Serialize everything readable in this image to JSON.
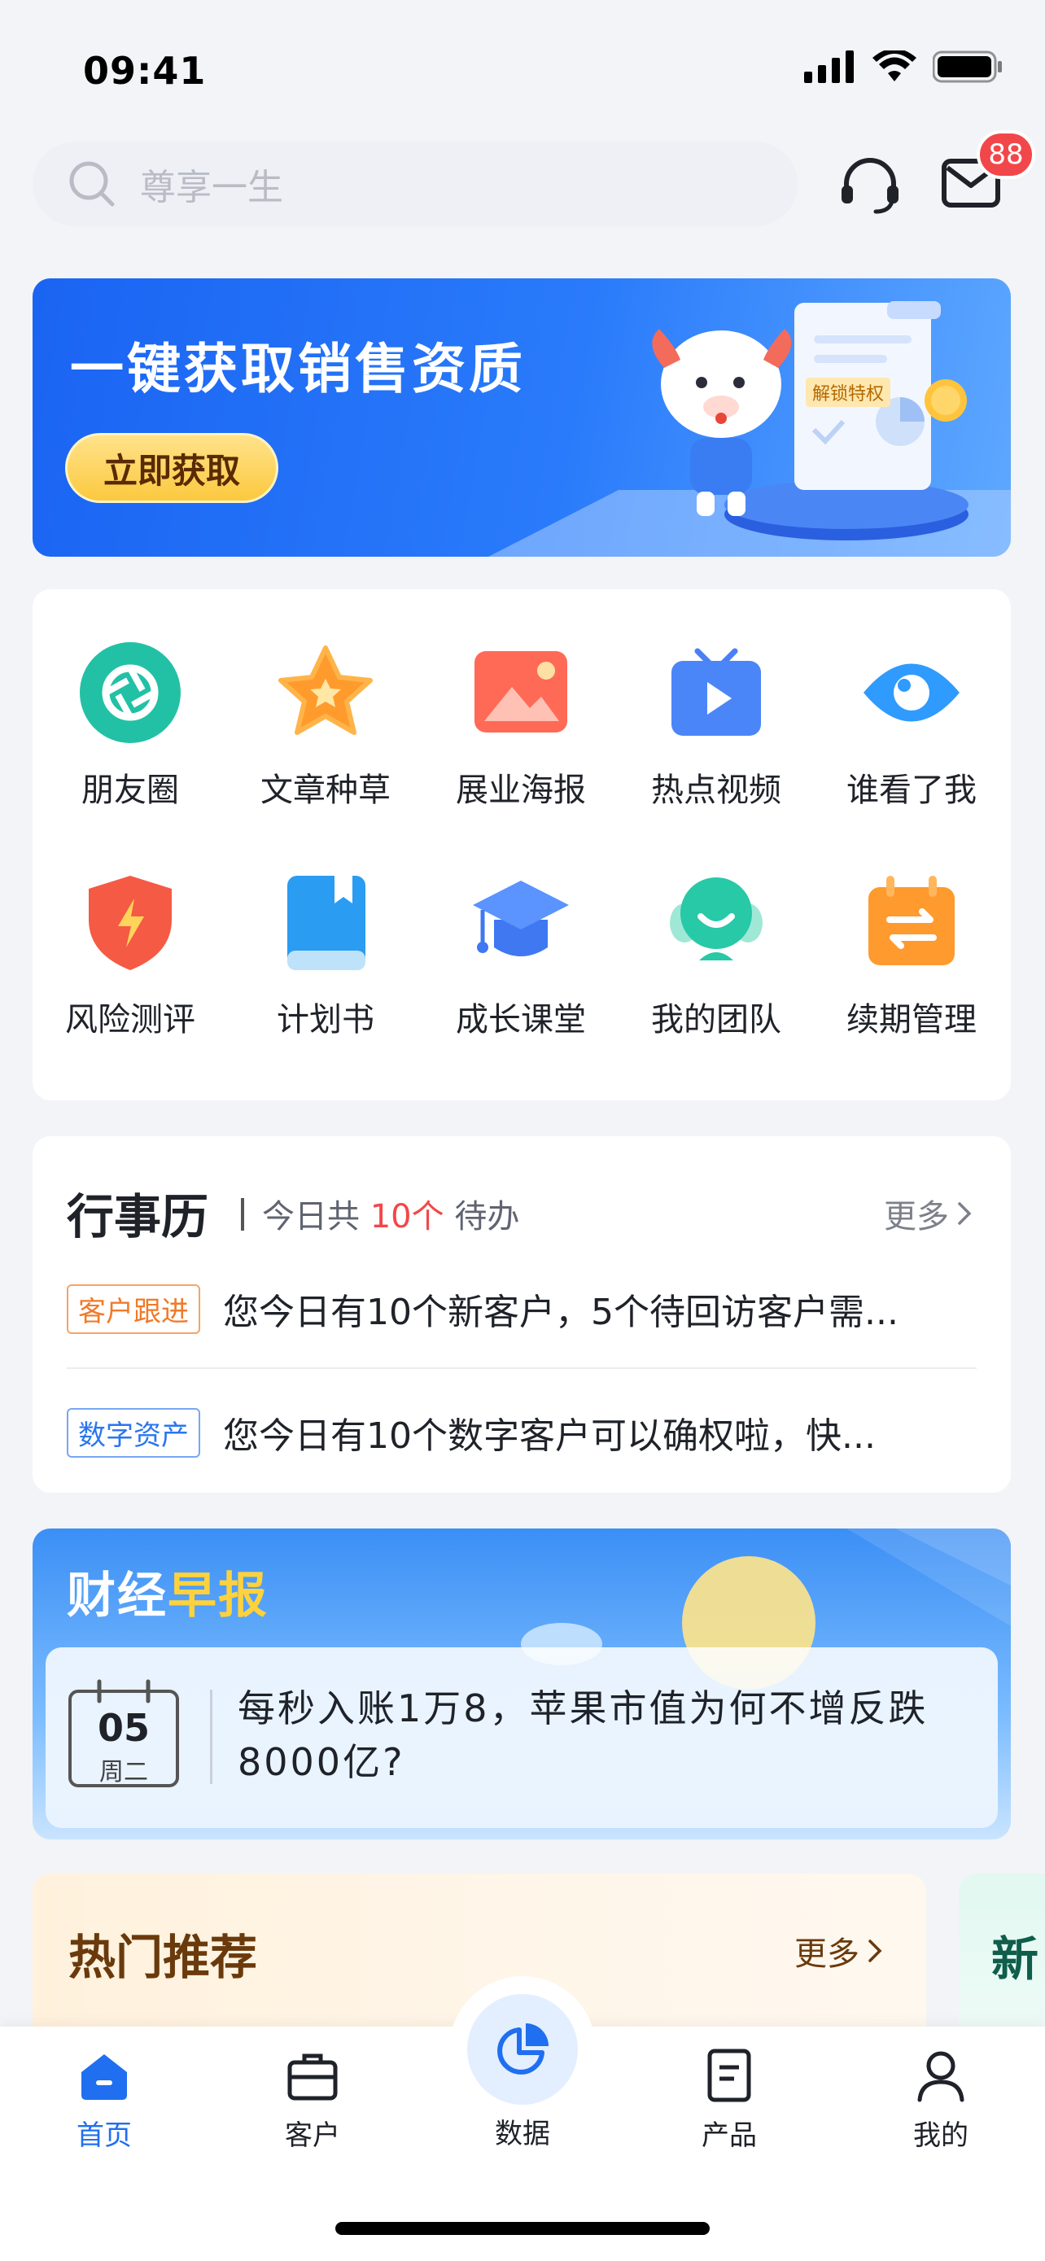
{
  "status_bar": {
    "time": "09:41"
  },
  "search": {
    "placeholder": "尊享一生"
  },
  "header": {
    "message_badge": "88"
  },
  "banner": {
    "title": "一键获取销售资质",
    "button": "立即获取",
    "scroll_tag": "解锁特权"
  },
  "grid": {
    "items": [
      {
        "label": "朋友圈",
        "icon": "aperture-icon"
      },
      {
        "label": "文章种草",
        "icon": "star-icon"
      },
      {
        "label": "展业海报",
        "icon": "image-icon"
      },
      {
        "label": "热点视频",
        "icon": "video-icon"
      },
      {
        "label": "谁看了我",
        "icon": "eye-icon"
      },
      {
        "label": "风险测评",
        "icon": "shield-bolt-icon"
      },
      {
        "label": "计划书",
        "icon": "book-icon"
      },
      {
        "label": "成长课堂",
        "icon": "graduation-cap-icon"
      },
      {
        "label": "我的团队",
        "icon": "team-icon"
      },
      {
        "label": "续期管理",
        "icon": "renewal-calendar-icon"
      }
    ]
  },
  "calendar": {
    "title": "行事历",
    "sub_prefix": "今日共",
    "count": "10个",
    "sub_suffix": "待办",
    "more": "更多",
    "items": [
      {
        "tag": "客户跟进",
        "text": "您今日有10个新客户，5个待回访客户需..."
      },
      {
        "tag": "数字资产",
        "text": "您今日有10个数字客户可以确权啦，快..."
      }
    ]
  },
  "finance": {
    "title_part1": "财经",
    "title_part2": "早报",
    "day": "05",
    "weekday": "周二",
    "headline": "每秒入账1万8，苹果市值为何不增反跌8000亿?"
  },
  "hot": {
    "title": "热门推荐",
    "more": "更多",
    "next_card_title": "新"
  },
  "tabbar": {
    "tabs": [
      {
        "label": "首页",
        "icon": "home-icon",
        "active": true
      },
      {
        "label": "客户",
        "icon": "briefcase-icon",
        "active": false
      },
      {
        "label": "数据",
        "icon": "pie-chart-icon",
        "active": false
      },
      {
        "label": "产品",
        "icon": "document-icon",
        "active": false
      },
      {
        "label": "我的",
        "icon": "user-icon",
        "active": false
      }
    ]
  },
  "colors": {
    "accent_blue": "#1f6ff0",
    "badge_red": "#f2474a",
    "tag_orange": "#f07a2a",
    "tag_blue": "#2a76ee"
  }
}
